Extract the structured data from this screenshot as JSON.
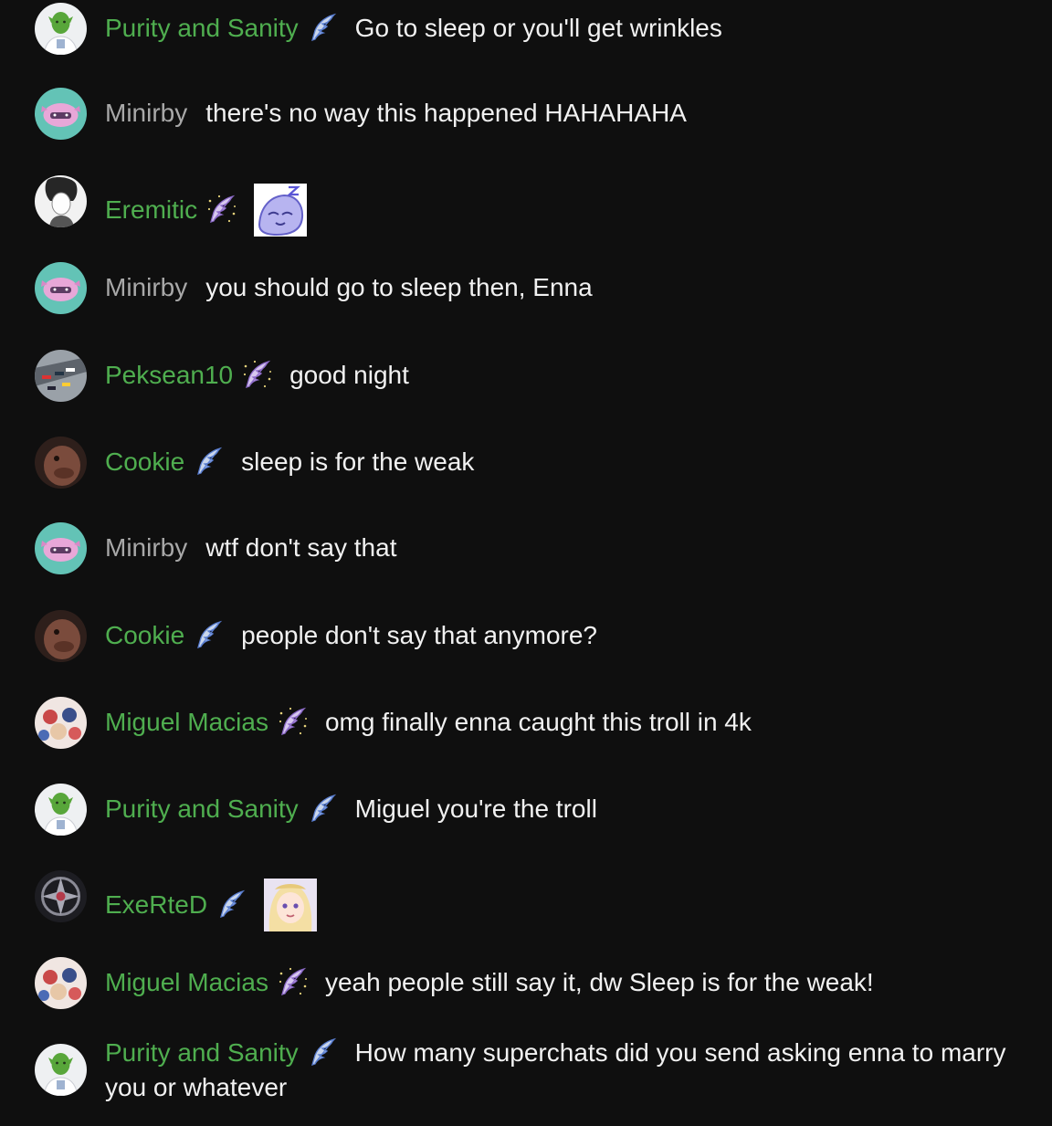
{
  "messages": [
    {
      "author": "Purity and Sanity",
      "author_style": "member",
      "badge": "member-feather-icon",
      "avatar": "green-character-avatar",
      "text": "Go to sleep or you'll get wrinkles"
    },
    {
      "author": "Minirby",
      "author_style": "plain",
      "badge": "",
      "avatar": "pink-axolotl-avatar",
      "text": "there's no way this happened HAHAHAHA"
    },
    {
      "author": "Eremitic",
      "author_style": "member",
      "badge": "member-sparkle-feather-icon",
      "avatar": "manga-portrait-avatar",
      "text": "",
      "emote": "sleepy-emote"
    },
    {
      "author": "Minirby",
      "author_style": "plain",
      "badge": "",
      "avatar": "pink-axolotl-avatar",
      "text": "you should go to sleep then, Enna"
    },
    {
      "author": "Peksean10",
      "author_style": "member",
      "badge": "member-sparkle-feather-icon",
      "avatar": "race-cars-avatar",
      "text": "good night"
    },
    {
      "author": "Cookie",
      "author_style": "member",
      "badge": "member-feather-icon",
      "avatar": "brown-creature-avatar",
      "text": "sleep is for the weak"
    },
    {
      "author": "Minirby",
      "author_style": "plain",
      "badge": "",
      "avatar": "pink-axolotl-avatar",
      "text": "wtf don't say that"
    },
    {
      "author": "Cookie",
      "author_style": "member",
      "badge": "member-feather-icon",
      "avatar": "brown-creature-avatar",
      "text": "people don't say that anymore?"
    },
    {
      "author": "Miguel Macias",
      "author_style": "member",
      "badge": "member-sparkle-feather-icon",
      "avatar": "anime-group-avatar",
      "text": "omg finally enna caught this troll in 4k"
    },
    {
      "author": "Purity and Sanity",
      "author_style": "member",
      "badge": "member-feather-icon",
      "avatar": "green-character-avatar",
      "text": "Miguel you're the troll"
    },
    {
      "author": "ExeRteD",
      "author_style": "member",
      "badge": "member-feather-icon",
      "avatar": "dark-emblem-avatar",
      "text": "",
      "emote": "blonde-girl-emote"
    },
    {
      "author": "Miguel Macias",
      "author_style": "member",
      "badge": "member-sparkle-feather-icon",
      "avatar": "anime-group-avatar",
      "text": "yeah people still say it, dw Sleep is for the weak!"
    },
    {
      "author": "Purity and Sanity",
      "author_style": "member",
      "badge": "member-feather-icon",
      "avatar": "green-character-avatar",
      "text": "How many superchats did you send asking enna to marry you or whatever"
    }
  ],
  "colors": {
    "background": "#0f0f0f",
    "member_name": "#4fae4f",
    "plain_name": "#a8a8a8",
    "message_text": "#f1f1f1"
  }
}
